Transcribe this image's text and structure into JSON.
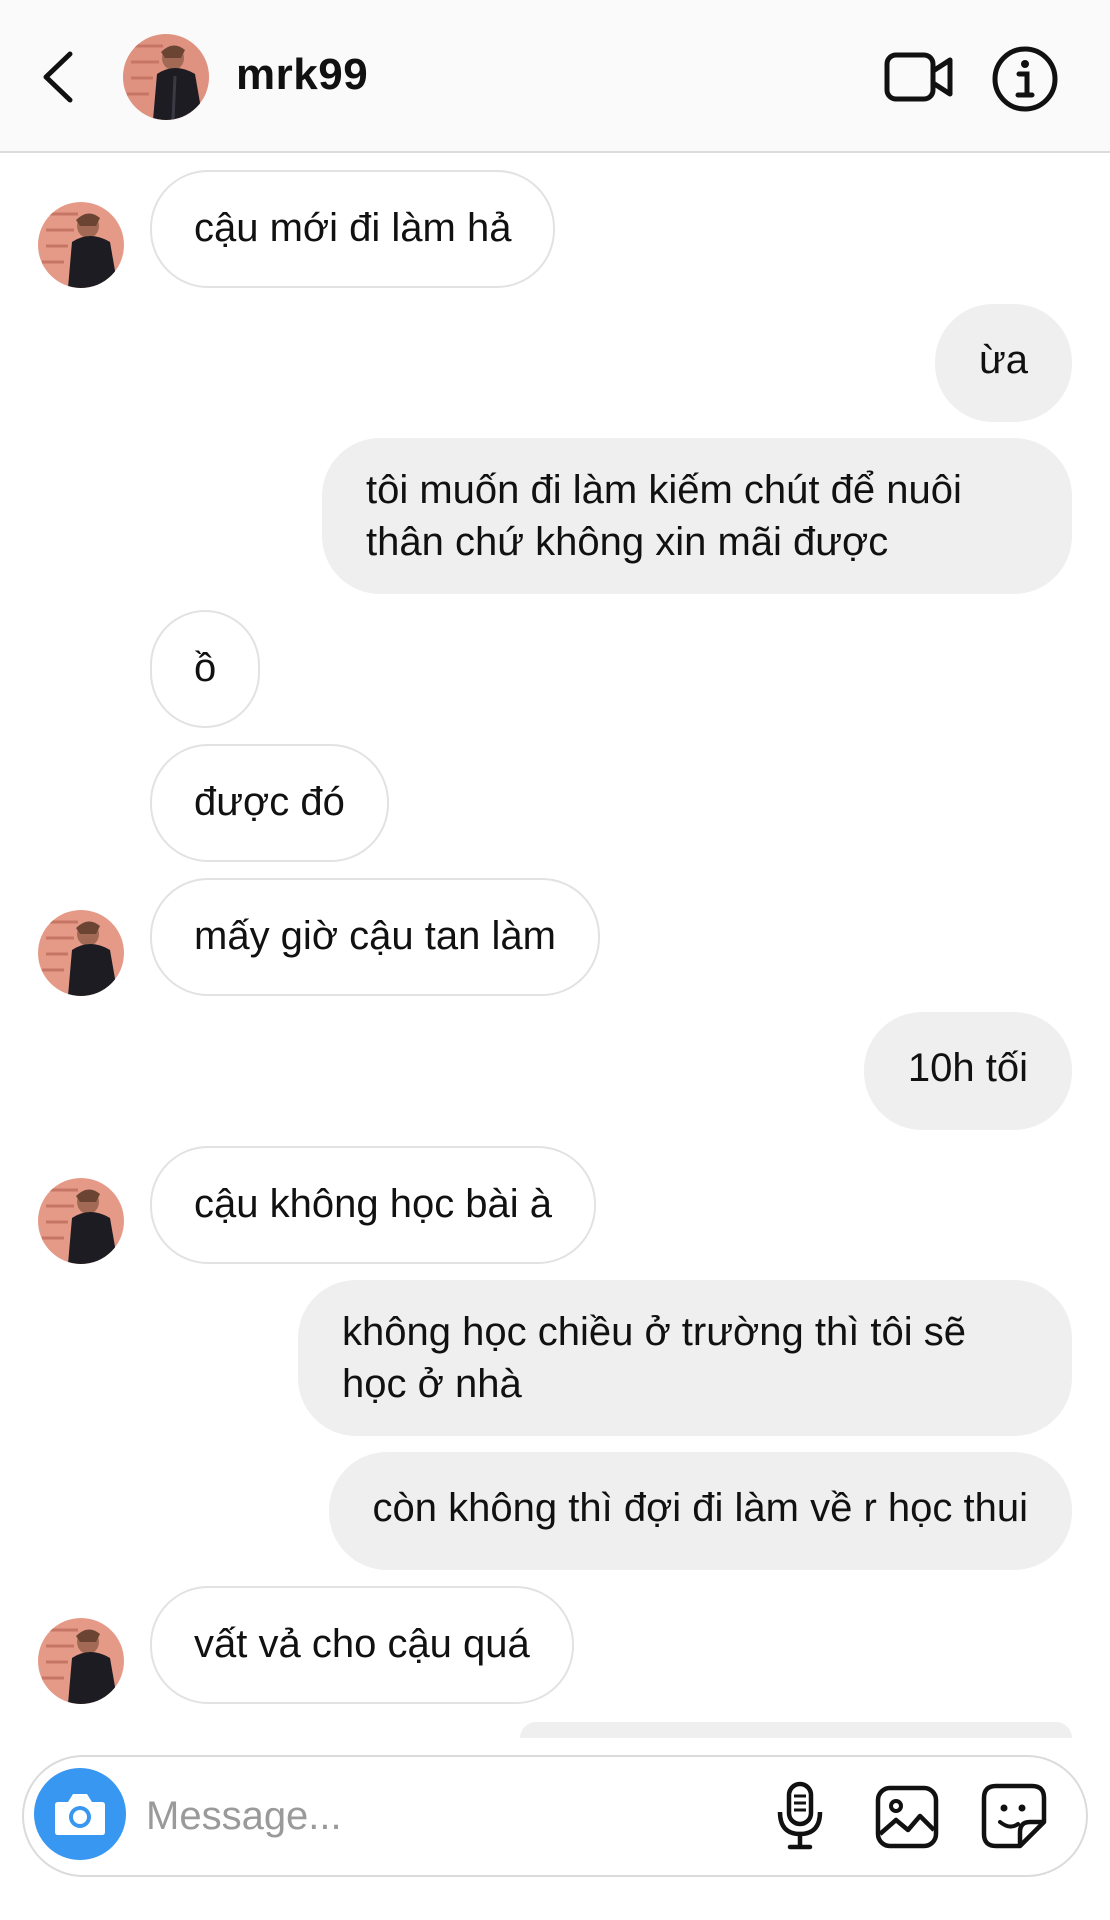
{
  "header": {
    "username": "mrk99",
    "icons": {
      "back": "chevron-left-icon",
      "video": "video-camera-icon",
      "info": "info-icon"
    }
  },
  "messages": [
    {
      "direction": "in",
      "text": "cậu mới đi làm hả",
      "show_avatar": true
    },
    {
      "direction": "out",
      "text": "ừa"
    },
    {
      "direction": "out",
      "lines": [
        "tôi muốn đi làm kiếm chút để nuôi",
        "thân chứ không xin mãi được"
      ]
    },
    {
      "direction": "in",
      "text": "ồ",
      "show_avatar": false
    },
    {
      "direction": "in",
      "text": "được đó",
      "show_avatar": false
    },
    {
      "direction": "in",
      "text": "mấy giờ cậu tan làm",
      "show_avatar": true
    },
    {
      "direction": "out",
      "text": "10h tối"
    },
    {
      "direction": "in",
      "text": "cậu không học bài à",
      "show_avatar": true
    },
    {
      "direction": "out",
      "lines": [
        "không học chiều ở trường thì tôi sẽ",
        "học ở nhà"
      ]
    },
    {
      "direction": "out",
      "text": "còn không thì đợi đi làm về r học thui"
    },
    {
      "direction": "in",
      "text": "vất vả cho cậu quá",
      "show_avatar": true
    }
  ],
  "composer": {
    "placeholder": "Message...",
    "icons": {
      "camera": "camera-icon",
      "mic": "microphone-icon",
      "gallery": "gallery-icon",
      "sticker": "sticker-icon"
    }
  },
  "colors": {
    "camera_button": "#3897f0",
    "incoming_bubble_border": "#e2e2e2",
    "outgoing_bubble_bg": "#efefef",
    "header_bg": "#fafafa"
  }
}
